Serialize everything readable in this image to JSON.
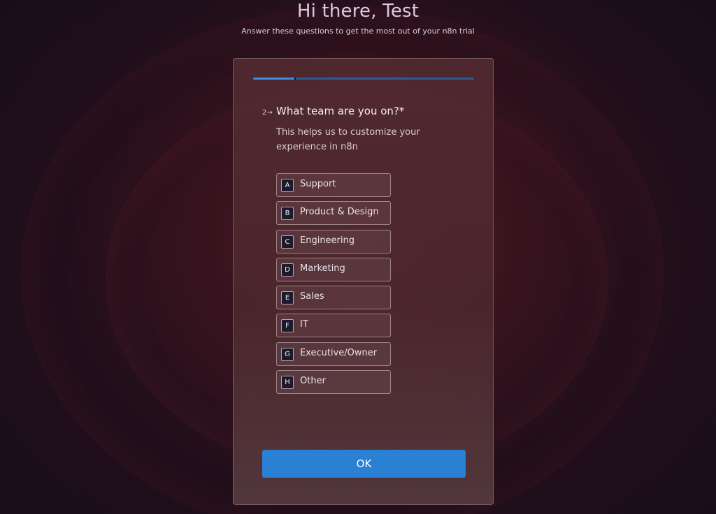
{
  "header": {
    "title": "Hi there, Test",
    "subtitle": "Answer these questions to get the most out of your n8n trial"
  },
  "progress": {
    "fraction": 0.19,
    "color": "#3d8ee0",
    "track_color": "#2b5d92"
  },
  "question": {
    "number": "2→",
    "title": "What team are you on?*",
    "description": "This helps us to customize your experience in n8n"
  },
  "options": [
    {
      "key": "A",
      "label": "Support"
    },
    {
      "key": "B",
      "label": "Product & Design"
    },
    {
      "key": "C",
      "label": "Engineering"
    },
    {
      "key": "D",
      "label": "Marketing"
    },
    {
      "key": "E",
      "label": "Sales"
    },
    {
      "key": "F",
      "label": "IT"
    },
    {
      "key": "G",
      "label": "Executive/Owner"
    },
    {
      "key": "H",
      "label": "Other"
    }
  ],
  "submit": {
    "label": "OK",
    "color": "#2a80d2"
  }
}
